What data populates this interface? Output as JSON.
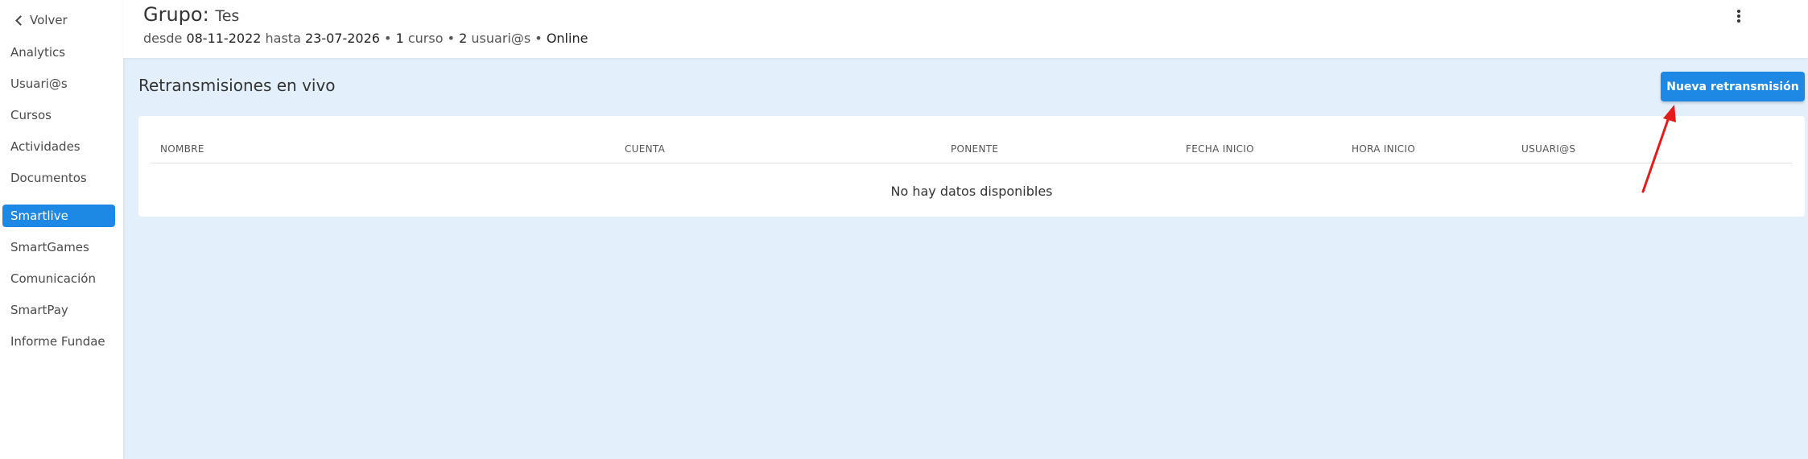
{
  "sidebar": {
    "back_label": "Volver",
    "items": [
      {
        "label": "Analytics"
      },
      {
        "label": "Usuari@s"
      },
      {
        "label": "Cursos"
      },
      {
        "label": "Actividades"
      },
      {
        "label": "Documentos"
      },
      {
        "label": "Smartlive",
        "active": true
      },
      {
        "label": "SmartGames"
      },
      {
        "label": "Comunicación"
      },
      {
        "label": "SmartPay"
      },
      {
        "label": "Informe Fundae"
      }
    ]
  },
  "header": {
    "title_prefix": "Grupo:",
    "group_name": "Tes",
    "meta": {
      "from_label": "desde",
      "from_date": "08-11-2022",
      "to_label": "hasta",
      "to_date": "23-07-2026",
      "courses_count": "1",
      "courses_label": "curso",
      "users_count": "2",
      "users_label": "usuari@s",
      "mode": "Online"
    }
  },
  "main": {
    "section_title": "Retransmisiones en vivo",
    "new_button_label": "Nueva retransmisión",
    "table": {
      "columns": [
        "NOMBRE",
        "CUENTA",
        "PONENTE",
        "FECHA INICIO",
        "HORA INICIO",
        "USUARI@S"
      ],
      "empty_text": "No hay datos disponibles"
    }
  },
  "colors": {
    "accent": "#1e88e5",
    "background": "#e3f0fb",
    "annotation_arrow": "#e31b1b"
  }
}
